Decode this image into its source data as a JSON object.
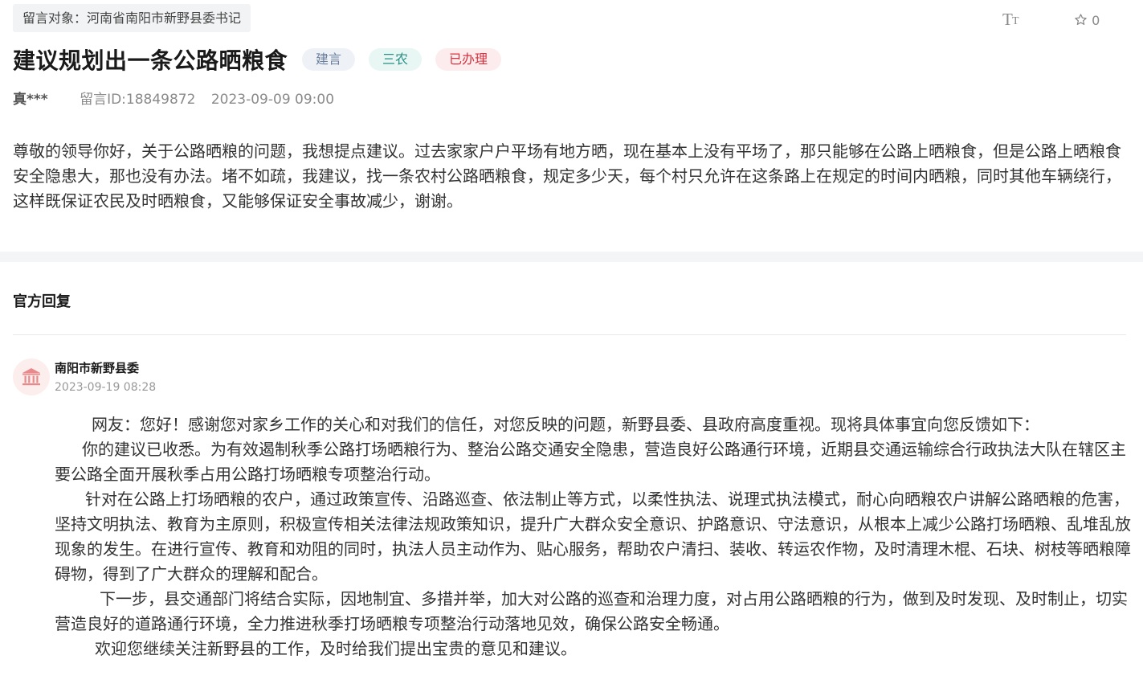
{
  "header": {
    "target_label": "留言对象：河南省南阳市新野县委书记",
    "favorite_count": "0",
    "font_size_icon": "text-size-icon",
    "favorite_icon": "star-outline-icon"
  },
  "message": {
    "title": "建议规划出一条公路晒粮食",
    "tags": [
      "建言",
      "三农",
      "已办理"
    ],
    "author": "真***",
    "message_id": "留言ID:18849872",
    "datetime": "2023-09-09 09:00",
    "content": "尊敬的领导你好，关于公路晒粮的问题，我想提点建议。过去家家户户平场有地方晒，现在基本上没有平场了，那只能够在公路上晒粮食，但是公路上晒粮食安全隐患大，那也没有办法。堵不如疏，我建议，找一条农村公路晒粮食，规定多少天，每个村只允许在这条路上在规定的时间内晒粮，同时其他车辆绕行，这样既保证农民及时晒粮食，又能够保证安全事故减少，谢谢。"
  },
  "reply": {
    "section_title": "官方回复",
    "replier": "南阳市新野县委",
    "datetime": "2023-09-19 08:28",
    "avatar_icon": "government-building-icon",
    "paragraphs": [
      "网友：您好！感谢您对家乡工作的关心和对我们的信任，对您反映的问题，新野县委、县政府高度重视。现将具体事宜向您反馈如下：",
      "你的建议已收悉。为有效遏制秋季公路打场晒粮行为、整治公路交通安全隐患，营造良好公路通行环境，近期县交通运输综合行政执法大队在辖区主要公路全面开展秋季占用公路打场晒粮专项整治行动。",
      "针对在公路上打场晒粮的农户，通过政策宣传、沿路巡查、依法制止等方式，以柔性执法、说理式执法模式，耐心向晒粮农户讲解公路晒粮的危害，坚持文明执法、教育为主原则，积极宣传相关法律法规政策知识，提升广大群众安全意识、护路意识、守法意识，从根本上减少公路打场晒粮、乱堆乱放现象的发生。在进行宣传、教育和劝阻的同时，执法人员主动作为、贴心服务，帮助农户清扫、装收、转运农作物，及时清理木棍、石块、树枝等晒粮障碍物，得到了广大群众的理解和配合。",
      "下一步，县交通部门将结合实际，因地制宜、多措并举，加大对公路的巡查和治理力度，对占用公路晒粮的行为，做到及时发现、及时制止，切实营造良好的道路通行环境，全力推进秋季打场晒粮专项整治行动落地见效，确保公路安全畅通。",
      "欢迎您继续关注新野县的工作，及时给我们提出宝贵的意见和建议。"
    ]
  },
  "colors": {
    "tag_jianyan": "#6b7f9e",
    "tag_sannong": "#2a8f84",
    "tag_done": "#d6333f",
    "avatar_accent": "#e8898b"
  }
}
